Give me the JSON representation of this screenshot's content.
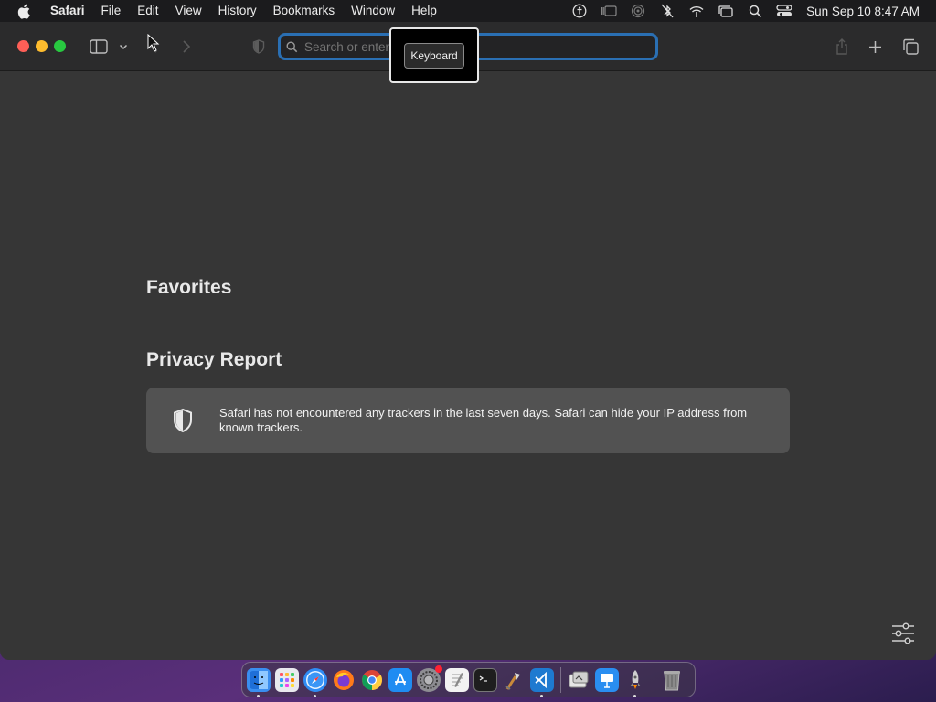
{
  "menubar": {
    "app_name": "Safari",
    "items": [
      "File",
      "Edit",
      "View",
      "History",
      "Bookmarks",
      "Window",
      "Help"
    ],
    "clock": "Sun Sep 10  8:47 AM"
  },
  "toolbar": {
    "address_placeholder": "Search or enter website name",
    "tooltip": "Keyboard"
  },
  "content": {
    "favorites_heading": "Favorites",
    "privacy_heading": "Privacy Report",
    "privacy_text": "Safari has not encountered any trackers in the last seven days. Safari can hide your IP address from known trackers."
  },
  "dock": {
    "apps": [
      {
        "name": "finder",
        "color": "#3a8ef0",
        "running": true
      },
      {
        "name": "launchpad",
        "color": "#e9e9ee",
        "running": false
      },
      {
        "name": "safari",
        "color": "#2f8cf4",
        "running": true
      },
      {
        "name": "firefox",
        "color": "#ff7a1a",
        "running": false
      },
      {
        "name": "chrome",
        "color": "#ffffff",
        "running": false
      },
      {
        "name": "app-store",
        "color": "#1f8cf2",
        "running": false
      },
      {
        "name": "system-settings",
        "color": "#8d8d92",
        "running": false
      },
      {
        "name": "textedit",
        "color": "#f2f2f2",
        "running": false
      },
      {
        "name": "terminal",
        "color": "#1e1e1e",
        "running": false
      },
      {
        "name": "instruments",
        "color": "#3d3d3d",
        "running": false
      },
      {
        "name": "vscode",
        "color": "#1e7ad0",
        "running": true
      },
      {
        "name": "preview",
        "color": "#d9d9d9",
        "running": false
      },
      {
        "name": "keynote",
        "color": "#2a8ef1",
        "running": false
      },
      {
        "name": "rocket",
        "color": "#4b4b4b",
        "running": true
      },
      {
        "name": "trash",
        "color": "#6e6e6e",
        "running": false
      }
    ]
  }
}
